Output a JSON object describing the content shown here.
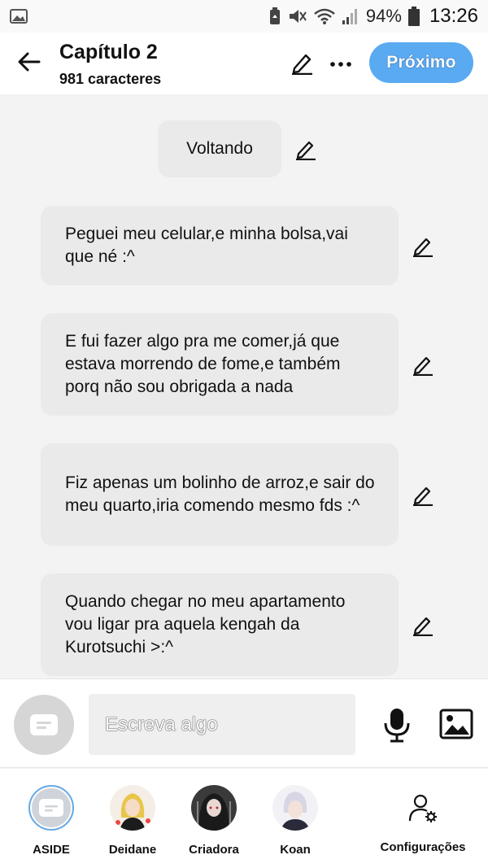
{
  "status_bar": {
    "battery": "94%",
    "time": "13:26"
  },
  "header": {
    "title": "Capítulo 2",
    "subtitle": "981 caracteres",
    "next_label": "Próximo"
  },
  "content": {
    "chapter_heading": "Voltando",
    "paragraphs": [
      "Peguei meu celular,e minha bolsa,vai que né :^",
      "E fui fazer algo pra me comer,já que estava morrendo de fome,e também porq não sou obrigada a nada",
      "Fiz apenas um bolinho de arroz,e sair do meu quarto,iria comendo mesmo fds :^",
      "Quando chegar no meu apartamento vou ligar pra aquela kengah da Kurotsuchi >:^"
    ]
  },
  "compose": {
    "placeholder": "Escreva algo"
  },
  "nav": {
    "items": [
      {
        "label": "ASIDE"
      },
      {
        "label": "Deidane"
      },
      {
        "label": "Criadora"
      },
      {
        "label": "Koan"
      },
      {
        "label": "Configurações"
      }
    ]
  },
  "colors": {
    "accent": "#5aaaf2",
    "bubble": "#eaeaea",
    "background": "#f3f3f3"
  }
}
